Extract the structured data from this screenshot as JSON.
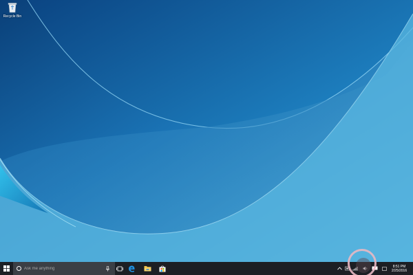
{
  "desktop": {
    "icons": [
      {
        "label": "Recycle Bin",
        "icon": "recycle-bin-icon"
      }
    ]
  },
  "taskbar": {
    "start_icon": "windows-logo-icon",
    "search": {
      "placeholder": "Ask me anything",
      "value": "",
      "icon": "cortana-icon",
      "mic_icon": "microphone-icon"
    },
    "pinned": [
      {
        "name": "Task View",
        "icon": "task-view-icon"
      },
      {
        "name": "Microsoft Edge",
        "icon": "edge-icon"
      },
      {
        "name": "File Explorer",
        "icon": "folder-icon"
      },
      {
        "name": "Store",
        "icon": "store-icon"
      }
    ],
    "tray": {
      "icons": [
        "chevron-up-icon",
        "tray-icon",
        "network-icon",
        "volume-icon",
        "action-center-icon"
      ],
      "time": "8:51 PM",
      "date": "2/25/2016"
    }
  },
  "colors": {
    "taskbar": "#1c1f24",
    "search_box": "#3b3f45",
    "wallpaper_dark": "#0d4f8a",
    "wallpaper_light": "#5ab5de",
    "highlight_ring": "#e8b8c3"
  }
}
